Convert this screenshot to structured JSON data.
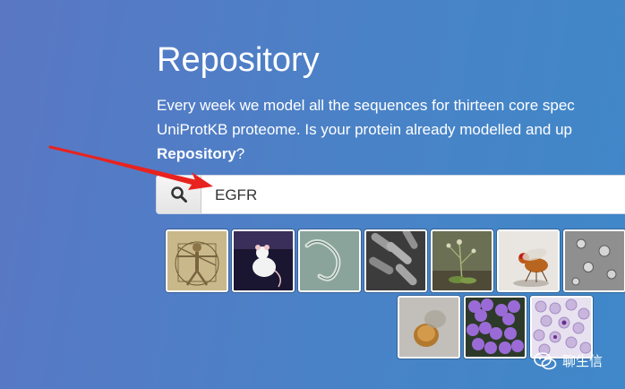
{
  "heading": "Repository",
  "description": {
    "line1": "Every week we model all the sequences for thirteen core spec",
    "line2": "UniProtKB proteome. Is your protein already modelled and up",
    "line3_bold": "Repository",
    "line3_rest": "?"
  },
  "search": {
    "value": "EGFR",
    "icon": "search-icon"
  },
  "organisms": {
    "row1": [
      "human-vitruvian",
      "mouse",
      "worm",
      "bacteria-rods",
      "plant",
      "fruit-fly",
      "yeast-cells"
    ],
    "row2": [
      "frog-egg",
      "staphylococcus",
      "blood-smear"
    ]
  },
  "annotation": {
    "color": "#e8231f"
  },
  "watermark": {
    "text": "聊生信",
    "icon": "wechat-icon"
  }
}
